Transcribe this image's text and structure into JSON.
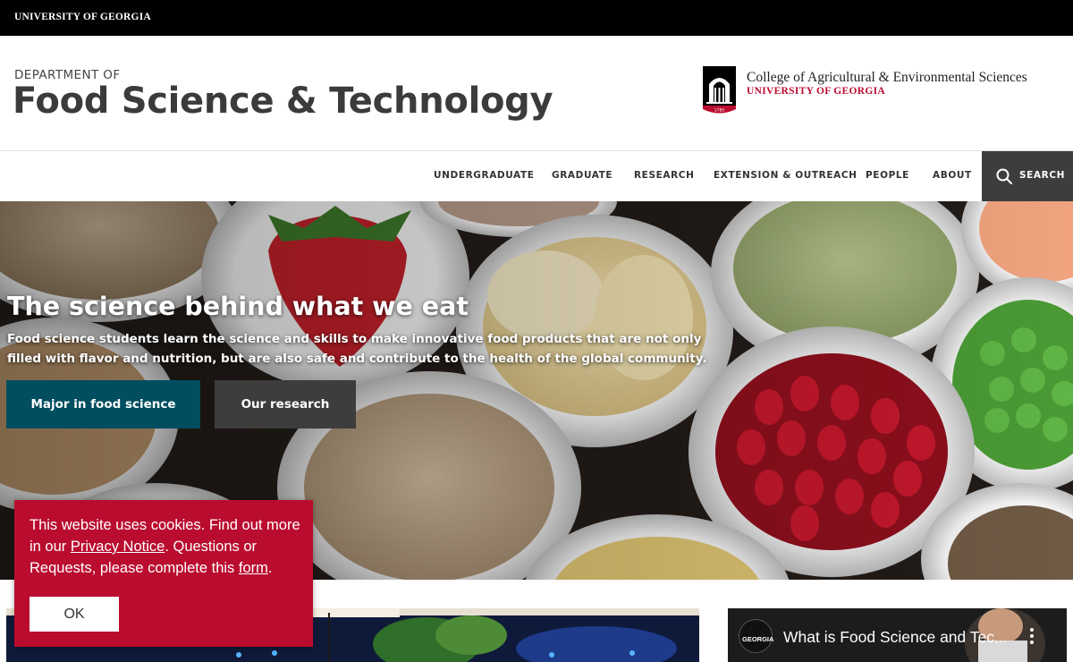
{
  "topbar": {
    "university_link": "UNIVERSITY OF GEORGIA"
  },
  "header": {
    "department_prefix": "DEPARTMENT OF",
    "department_name": "Food Science & Technology",
    "college_name": "College of Agricultural & Environmental Sciences",
    "college_university": "UNIVERSITY OF GEORGIA",
    "arch_year": "1785"
  },
  "nav": {
    "items": [
      {
        "label": "UNDERGRADUATE"
      },
      {
        "label": "GRADUATE"
      },
      {
        "label": "RESEARCH"
      },
      {
        "label": "EXTENSION & OUTREACH"
      },
      {
        "label": "PEOPLE"
      },
      {
        "label": "ABOUT"
      }
    ],
    "search_label": "SEARCH"
  },
  "hero": {
    "title": "The science behind what we eat",
    "subtitle": "Food science students learn the science and skills to make innovative food products that are not only filled with flavor and nutrition, but are also safe and contribute to the health of the global community.",
    "primary_button": "Major in food science",
    "secondary_button": "Our research"
  },
  "video": {
    "channel_logo_text": "GEORGIA",
    "title": "What is Food Science and Tec..."
  },
  "cookie": {
    "text_1": "This website uses cookies. Find out more in our ",
    "privacy_link": "Privacy Notice",
    "text_2": ". Questions or Requests, please complete this ",
    "form_link": "form",
    "text_3": ".",
    "ok_button": "OK"
  },
  "colors": {
    "uga_red": "#ba0c2f",
    "primary_button_teal": "#004e60",
    "dark_gray": "#3d3d3d"
  }
}
